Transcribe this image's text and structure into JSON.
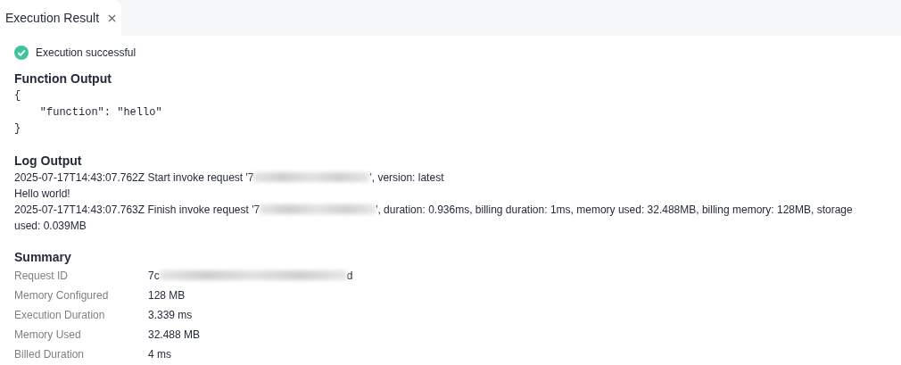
{
  "tabs": [
    {
      "label": "Execution Result",
      "selected": true,
      "closable": true
    }
  ],
  "status": {
    "kind": "success",
    "text": "Execution successful"
  },
  "function_output": {
    "title": "Function Output",
    "lines": [
      "{",
      "    \"function\": \"hello\"",
      "}"
    ]
  },
  "log_output": {
    "title": "Log Output",
    "lines": [
      {
        "before": "2025-07-17T14:43:07.762Z Start invoke request '7",
        "redacted": true,
        "after": "', version: latest"
      },
      {
        "before": "Hello world!"
      },
      {
        "before": "2025-07-17T14:43:07.763Z Finish invoke request '7",
        "redacted": true,
        "after": "', duration: 0.936ms, billing duration: 1ms, memory used: 32.488MB, billing memory: 128MB, storage used: 0.039MB"
      }
    ]
  },
  "summary": {
    "title": "Summary",
    "rows": [
      {
        "label": "Request ID",
        "value": "7c",
        "redacted": true,
        "value_after": "d"
      },
      {
        "label": "Memory Configured",
        "value": "128 MB"
      },
      {
        "label": "Execution Duration",
        "value": "3.339 ms"
      },
      {
        "label": "Memory Used",
        "value": "32.488 MB"
      },
      {
        "label": "Billed Duration",
        "value": "4 ms"
      }
    ]
  }
}
